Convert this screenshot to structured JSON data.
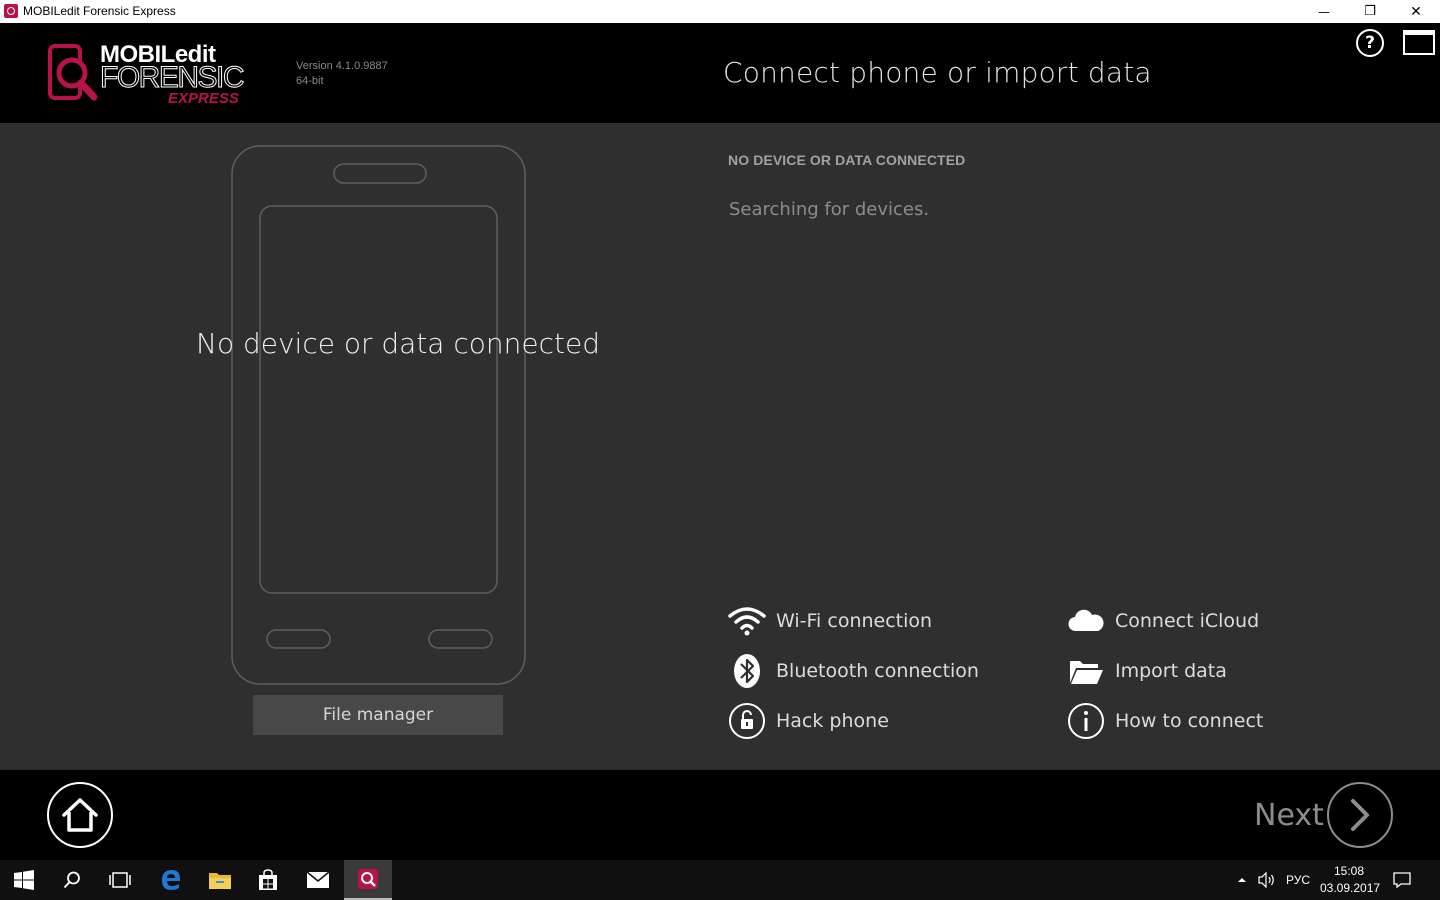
{
  "window": {
    "title": "MOBILedit Forensic Express",
    "minimize_glyph": "—",
    "restore_glyph": "❐",
    "close_glyph": "✕"
  },
  "header": {
    "logo": {
      "line1": "MOBILedit",
      "line2": "FORENSIC",
      "line3": "EXPRESS"
    },
    "version": "Version 4.1.0.9887",
    "arch": "64-bit",
    "title": "Connect phone or import data",
    "help_label": "?"
  },
  "left_panel": {
    "placeholder_text": "No device or data connected",
    "file_manager_label": "File manager"
  },
  "right_panel": {
    "status_heading": "NO DEVICE OR DATA CONNECTED",
    "status_message": "Searching for devices.",
    "actions": [
      {
        "label": "Wi-Fi connection",
        "icon": "wifi-icon"
      },
      {
        "label": "Bluetooth connection",
        "icon": "bluetooth-icon"
      },
      {
        "label": "Hack phone",
        "icon": "unlock-icon"
      },
      {
        "label": "Connect iCloud",
        "icon": "cloud-icon"
      },
      {
        "label": "Import data",
        "icon": "folder-icon"
      },
      {
        "label": "How to connect",
        "icon": "info-icon"
      }
    ]
  },
  "footer": {
    "next_label": "Next"
  },
  "taskbar": {
    "items": [
      "start-icon",
      "search-icon",
      "task-view-icon",
      "edge-icon",
      "file-explorer-icon",
      "store-icon",
      "mail-icon",
      "mobiledit-icon"
    ],
    "tray": {
      "language": "РУС",
      "time": "15:08",
      "date": "03.09.2017"
    }
  },
  "colors": {
    "brand_accent": "#b7124a",
    "main_bg": "#2f2f2f",
    "header_bg": "#000000"
  }
}
